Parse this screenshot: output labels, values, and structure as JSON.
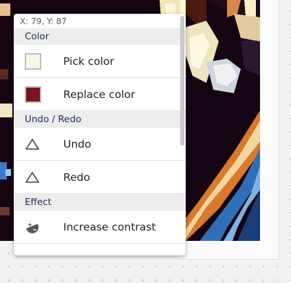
{
  "coordinates": "X: 79, Y: 87",
  "colors": {
    "pick_swatch": "#f8f6e4",
    "replace_swatch": "#7a1420",
    "section_bg": "#ededed",
    "section_text": "#1f2a55"
  },
  "menu": {
    "sections": {
      "color": "Color",
      "undo_redo": "Undo / Redo",
      "effect": "Effect"
    },
    "items": {
      "pick_color": "Pick color",
      "replace_color": "Replace color",
      "undo": "Undo",
      "redo": "Redo",
      "increase_contrast": "Increase contrast"
    },
    "icons": {
      "pick_color": "color-swatch-icon",
      "replace_color": "color-swatch-icon",
      "undo": "triangle-icon",
      "redo": "triangle-icon",
      "increase_contrast": "contrast-icon"
    }
  }
}
